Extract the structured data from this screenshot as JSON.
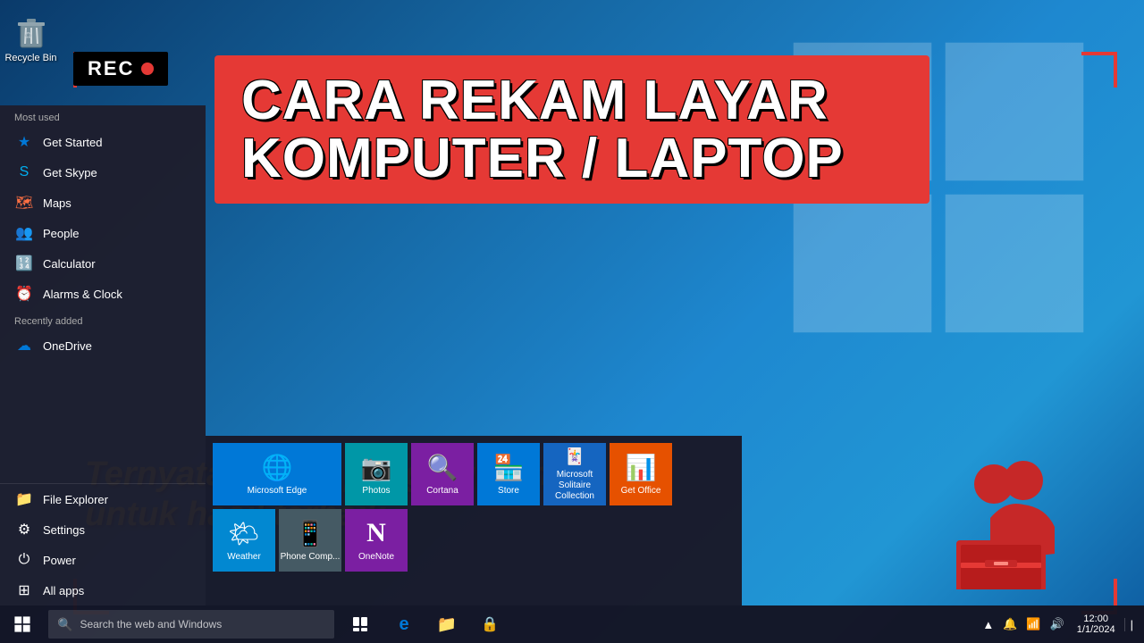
{
  "desktop": {
    "recycle_bin_label": "Recycle Bin"
  },
  "rec_indicator": {
    "label": "REC"
  },
  "title_banner": {
    "line1": "CARA REKAM LAYAR",
    "line2": "KOMPUTER / LAPTOP"
  },
  "subtitle": {
    "line1": "Ternyata begini pengaturannya",
    "line2": "untuk hasil terbaik"
  },
  "start_menu": {
    "most_used_label": "Most used",
    "recently_added_label": "Recently added",
    "items_most_used": [
      {
        "icon": "🌟",
        "label": "Get Started",
        "color": "#0078d7"
      },
      {
        "icon": "S",
        "label": "Get Skype",
        "color": "#00aff0"
      },
      {
        "icon": "🗺",
        "label": "Maps",
        "color": "#ff7043"
      },
      {
        "icon": "👥",
        "label": "People",
        "color": "#0078d7"
      },
      {
        "icon": "🔢",
        "label": "Calculator",
        "color": "#555"
      },
      {
        "icon": "⏰",
        "label": "Alarms & Clock",
        "color": "#0078d7"
      }
    ],
    "items_recently_added": [
      {
        "icon": "☁",
        "label": "OneDrive",
        "color": "#0078d7"
      }
    ],
    "bottom_items": [
      {
        "icon": "📁",
        "label": "File Explorer"
      },
      {
        "icon": "⚙",
        "label": "Settings"
      },
      {
        "icon": "⏻",
        "label": "Power"
      },
      {
        "icon": "⊞",
        "label": "All apps"
      }
    ]
  },
  "tiles": {
    "row1": [
      {
        "icon": "🌐",
        "label": "Microsoft Edge",
        "color": "#0078d7",
        "size": "md"
      },
      {
        "icon": "📷",
        "label": "Photos",
        "color": "#0097a7",
        "size": "sm"
      },
      {
        "icon": "🔍",
        "label": "Cortana",
        "color": "#7b1fa2",
        "size": "sm"
      },
      {
        "icon": "🏪",
        "label": "Store",
        "color": "#0078d7",
        "size": "sm"
      },
      {
        "icon": "🃏",
        "label": "Microsoft Solitaire Collection",
        "color": "#1565c0",
        "size": "sm"
      },
      {
        "icon": "📊",
        "label": "Get Office",
        "color": "#e65100",
        "size": "sm"
      }
    ],
    "row2": [
      {
        "icon": "🌤",
        "label": "Weather",
        "color": "#0288d1",
        "size": "sm"
      },
      {
        "icon": "📱",
        "label": "Phone Comp...",
        "color": "#455a64",
        "size": "sm"
      },
      {
        "icon": "N",
        "label": "OneNote",
        "color": "#7b1fa2",
        "size": "sm"
      }
    ]
  },
  "taskbar": {
    "search_placeholder": "Search the web and Windows",
    "start_icon": "⊞",
    "time": "▲ 🔔 📶 🔊",
    "pinned_icons": [
      "🖥",
      "e",
      "📁",
      "🔒"
    ]
  }
}
